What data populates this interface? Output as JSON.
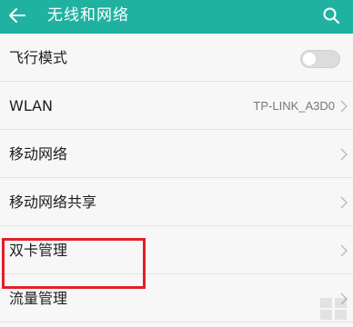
{
  "header": {
    "title": "无线和网络",
    "back_icon": "back-arrow-icon",
    "search_icon": "search-icon",
    "background_color": "#1fb2a0"
  },
  "settings": {
    "airplane_mode": {
      "label": "飞行模式",
      "toggle_on": false
    },
    "wlan": {
      "label": "WLAN",
      "value": "TP-LINK_A3D0"
    },
    "mobile_network": {
      "label": "移动网络"
    },
    "tethering": {
      "label": "移动网络共享"
    },
    "dual_sim": {
      "label": "双卡管理"
    },
    "data_usage": {
      "label": "流量管理"
    }
  },
  "annotation": {
    "highlight_color": "#e0202b"
  }
}
